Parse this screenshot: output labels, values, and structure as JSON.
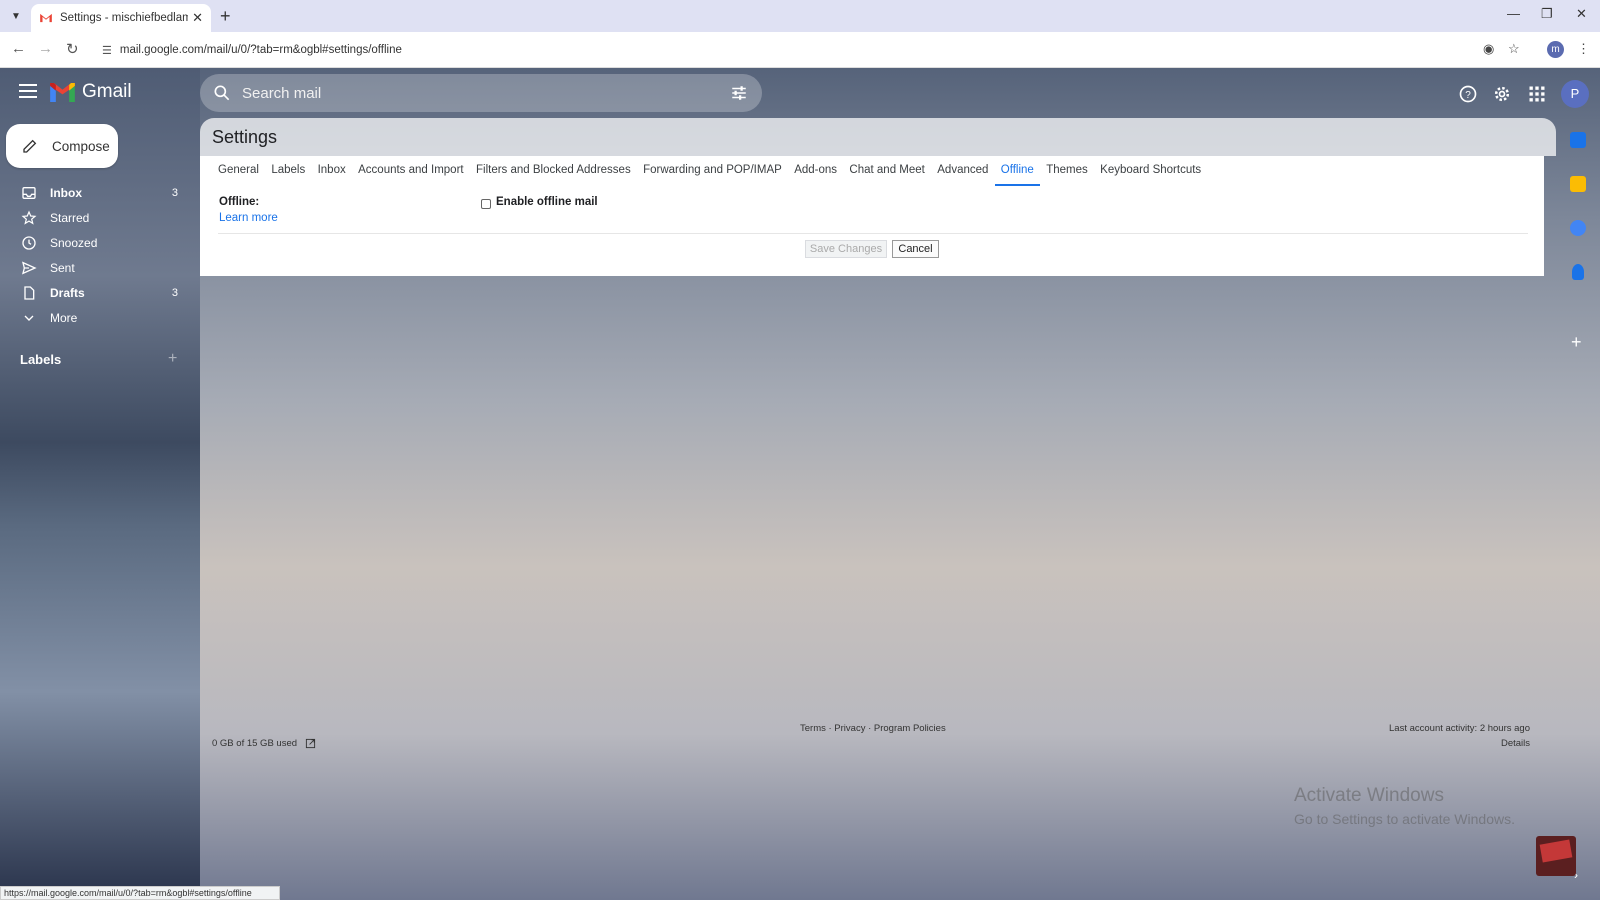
{
  "browser": {
    "tab_title": "Settings - mischiefbedlam@gm",
    "url": "mail.google.com/mail/u/0/?tab=rm&ogbl#settings/offline",
    "profile_initial": "m",
    "status_url": "https://mail.google.com/mail/u/0/?tab=rm&ogbl#settings/offline"
  },
  "gmail": {
    "logo_text": "Gmail",
    "search_placeholder": "Search mail",
    "avatar_initial": "P",
    "compose_label": "Compose"
  },
  "nav": {
    "items": [
      {
        "label": "Inbox",
        "count": "3",
        "icon": "inbox-icon",
        "bold": true
      },
      {
        "label": "Starred",
        "count": "",
        "icon": "star-icon",
        "bold": false
      },
      {
        "label": "Snoozed",
        "count": "",
        "icon": "clock-icon",
        "bold": false
      },
      {
        "label": "Sent",
        "count": "",
        "icon": "send-icon",
        "bold": false
      },
      {
        "label": "Drafts",
        "count": "3",
        "icon": "file-icon",
        "bold": true
      },
      {
        "label": "More",
        "count": "",
        "icon": "chevron-down-icon",
        "bold": false
      }
    ],
    "labels_header": "Labels"
  },
  "settings": {
    "title": "Settings",
    "tabs": [
      "General",
      "Labels",
      "Inbox",
      "Accounts and Import",
      "Filters and Blocked Addresses",
      "Forwarding and POP/IMAP",
      "Add-ons",
      "Chat and Meet",
      "Advanced",
      "Offline",
      "Themes",
      "Keyboard Shortcuts"
    ],
    "active_tab": "Offline",
    "offline_label": "Offline:",
    "learn_more": "Learn more",
    "enable_offline_label": "Enable offline mail",
    "enable_offline_checked": false,
    "save_label": "Save Changes",
    "cancel_label": "Cancel"
  },
  "footer": {
    "storage": "0 GB of 15 GB used",
    "links": "Terms · Privacy · Program Policies",
    "activity": "Last account activity: 2 hours ago",
    "details": "Details"
  },
  "watermark": {
    "line1": "Activate Windows",
    "line2": "Go to Settings to activate Windows."
  },
  "colors": {
    "accent": "#1a73e8",
    "gmail_red": "#ea4335"
  }
}
